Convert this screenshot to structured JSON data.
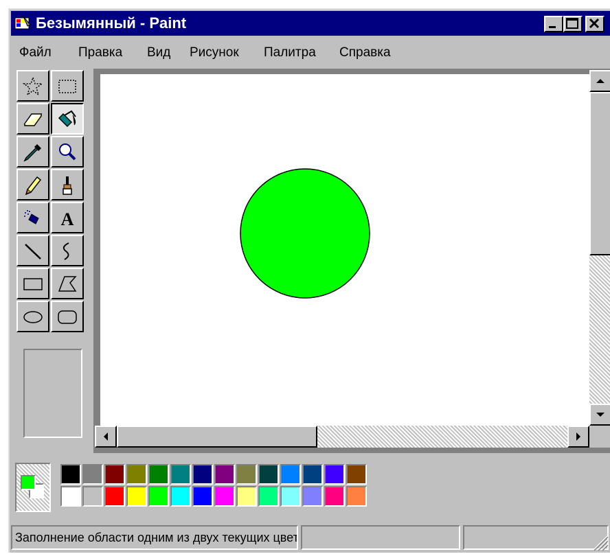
{
  "window": {
    "title": "Безымянный - Paint",
    "icon": "paint-app-icon",
    "controls": [
      "minimize",
      "maximize",
      "close"
    ]
  },
  "menu": [
    {
      "label": "Файл"
    },
    {
      "label": "Правка"
    },
    {
      "label": "Вид"
    },
    {
      "label": "Рисунок"
    },
    {
      "label": "Палитра"
    },
    {
      "label": "Справка"
    }
  ],
  "tools": [
    {
      "name": "free-form-select",
      "icon": "free-select-icon"
    },
    {
      "name": "rect-select",
      "icon": "rect-select-icon"
    },
    {
      "name": "eraser",
      "icon": "eraser-icon"
    },
    {
      "name": "fill",
      "icon": "fill-bucket-icon",
      "active": true
    },
    {
      "name": "pick-color",
      "icon": "eyedropper-icon"
    },
    {
      "name": "magnifier",
      "icon": "magnifier-icon"
    },
    {
      "name": "pencil",
      "icon": "pencil-icon"
    },
    {
      "name": "brush",
      "icon": "brush-icon"
    },
    {
      "name": "airbrush",
      "icon": "airbrush-icon"
    },
    {
      "name": "text",
      "icon": "text-icon",
      "glyph": "A"
    },
    {
      "name": "line",
      "icon": "line-icon"
    },
    {
      "name": "curve",
      "icon": "curve-icon"
    },
    {
      "name": "rectangle",
      "icon": "rectangle-icon"
    },
    {
      "name": "polygon",
      "icon": "polygon-icon"
    },
    {
      "name": "ellipse",
      "icon": "ellipse-icon"
    },
    {
      "name": "rounded-rectangle",
      "icon": "rounded-rectangle-icon"
    }
  ],
  "canvas": {
    "background": "#ffffff",
    "shape": {
      "type": "circle",
      "fill": "#00ff00",
      "stroke": "#000000"
    }
  },
  "colors": {
    "foreground": "#00ff00",
    "background": "#ffffff"
  },
  "palette": [
    [
      "#000000",
      "#808080",
      "#800000",
      "#808000",
      "#008000",
      "#008080",
      "#000080",
      "#800080",
      "#808040",
      "#004040",
      "#0080ff",
      "#004080",
      "#4000ff",
      "#804000"
    ],
    [
      "#ffffff",
      "#c0c0c0",
      "#ff0000",
      "#ffff00",
      "#00ff00",
      "#00ffff",
      "#0000ff",
      "#ff00ff",
      "#ffff80",
      "#00ff80",
      "#80ffff",
      "#8080ff",
      "#ff0080",
      "#ff8040"
    ]
  ],
  "status": {
    "message": "Заполнение области одним из двух текущих цветов",
    "coords": "",
    "size": ""
  }
}
